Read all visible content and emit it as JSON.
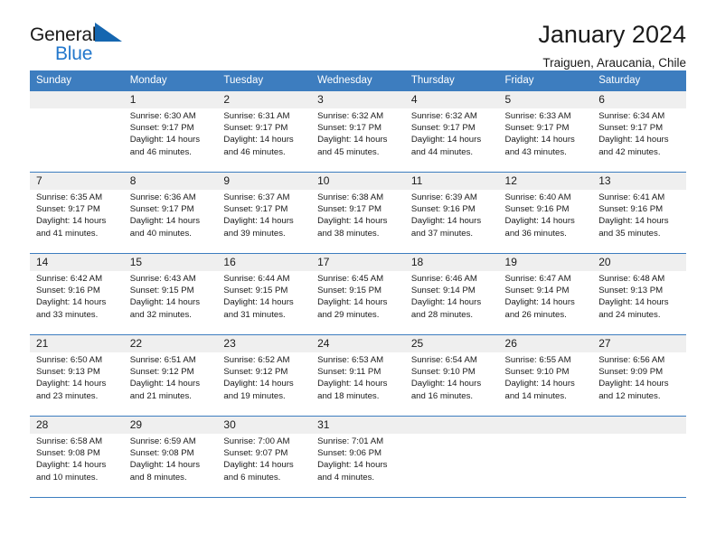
{
  "brand": {
    "name_top": "General",
    "name_bottom": "Blue",
    "mark": "triangle-flag-icon",
    "accent_color": "#2277cc"
  },
  "header": {
    "title": "January 2024",
    "subtitle": "Traiguen, Araucania, Chile"
  },
  "calendar": {
    "header_bg": "#3d7dbf",
    "daynum_bg": "#efefef",
    "weekdays": [
      "Sunday",
      "Monday",
      "Tuesday",
      "Wednesday",
      "Thursday",
      "Friday",
      "Saturday"
    ],
    "weeks": [
      [
        {
          "day": ""
        },
        {
          "day": "1",
          "sunrise": "Sunrise: 6:30 AM",
          "sunset": "Sunset: 9:17 PM",
          "daylight_1": "Daylight: 14 hours",
          "daylight_2": "and 46 minutes."
        },
        {
          "day": "2",
          "sunrise": "Sunrise: 6:31 AM",
          "sunset": "Sunset: 9:17 PM",
          "daylight_1": "Daylight: 14 hours",
          "daylight_2": "and 46 minutes."
        },
        {
          "day": "3",
          "sunrise": "Sunrise: 6:32 AM",
          "sunset": "Sunset: 9:17 PM",
          "daylight_1": "Daylight: 14 hours",
          "daylight_2": "and 45 minutes."
        },
        {
          "day": "4",
          "sunrise": "Sunrise: 6:32 AM",
          "sunset": "Sunset: 9:17 PM",
          "daylight_1": "Daylight: 14 hours",
          "daylight_2": "and 44 minutes."
        },
        {
          "day": "5",
          "sunrise": "Sunrise: 6:33 AM",
          "sunset": "Sunset: 9:17 PM",
          "daylight_1": "Daylight: 14 hours",
          "daylight_2": "and 43 minutes."
        },
        {
          "day": "6",
          "sunrise": "Sunrise: 6:34 AM",
          "sunset": "Sunset: 9:17 PM",
          "daylight_1": "Daylight: 14 hours",
          "daylight_2": "and 42 minutes."
        }
      ],
      [
        {
          "day": "7",
          "sunrise": "Sunrise: 6:35 AM",
          "sunset": "Sunset: 9:17 PM",
          "daylight_1": "Daylight: 14 hours",
          "daylight_2": "and 41 minutes."
        },
        {
          "day": "8",
          "sunrise": "Sunrise: 6:36 AM",
          "sunset": "Sunset: 9:17 PM",
          "daylight_1": "Daylight: 14 hours",
          "daylight_2": "and 40 minutes."
        },
        {
          "day": "9",
          "sunrise": "Sunrise: 6:37 AM",
          "sunset": "Sunset: 9:17 PM",
          "daylight_1": "Daylight: 14 hours",
          "daylight_2": "and 39 minutes."
        },
        {
          "day": "10",
          "sunrise": "Sunrise: 6:38 AM",
          "sunset": "Sunset: 9:17 PM",
          "daylight_1": "Daylight: 14 hours",
          "daylight_2": "and 38 minutes."
        },
        {
          "day": "11",
          "sunrise": "Sunrise: 6:39 AM",
          "sunset": "Sunset: 9:16 PM",
          "daylight_1": "Daylight: 14 hours",
          "daylight_2": "and 37 minutes."
        },
        {
          "day": "12",
          "sunrise": "Sunrise: 6:40 AM",
          "sunset": "Sunset: 9:16 PM",
          "daylight_1": "Daylight: 14 hours",
          "daylight_2": "and 36 minutes."
        },
        {
          "day": "13",
          "sunrise": "Sunrise: 6:41 AM",
          "sunset": "Sunset: 9:16 PM",
          "daylight_1": "Daylight: 14 hours",
          "daylight_2": "and 35 minutes."
        }
      ],
      [
        {
          "day": "14",
          "sunrise": "Sunrise: 6:42 AM",
          "sunset": "Sunset: 9:16 PM",
          "daylight_1": "Daylight: 14 hours",
          "daylight_2": "and 33 minutes."
        },
        {
          "day": "15",
          "sunrise": "Sunrise: 6:43 AM",
          "sunset": "Sunset: 9:15 PM",
          "daylight_1": "Daylight: 14 hours",
          "daylight_2": "and 32 minutes."
        },
        {
          "day": "16",
          "sunrise": "Sunrise: 6:44 AM",
          "sunset": "Sunset: 9:15 PM",
          "daylight_1": "Daylight: 14 hours",
          "daylight_2": "and 31 minutes."
        },
        {
          "day": "17",
          "sunrise": "Sunrise: 6:45 AM",
          "sunset": "Sunset: 9:15 PM",
          "daylight_1": "Daylight: 14 hours",
          "daylight_2": "and 29 minutes."
        },
        {
          "day": "18",
          "sunrise": "Sunrise: 6:46 AM",
          "sunset": "Sunset: 9:14 PM",
          "daylight_1": "Daylight: 14 hours",
          "daylight_2": "and 28 minutes."
        },
        {
          "day": "19",
          "sunrise": "Sunrise: 6:47 AM",
          "sunset": "Sunset: 9:14 PM",
          "daylight_1": "Daylight: 14 hours",
          "daylight_2": "and 26 minutes."
        },
        {
          "day": "20",
          "sunrise": "Sunrise: 6:48 AM",
          "sunset": "Sunset: 9:13 PM",
          "daylight_1": "Daylight: 14 hours",
          "daylight_2": "and 24 minutes."
        }
      ],
      [
        {
          "day": "21",
          "sunrise": "Sunrise: 6:50 AM",
          "sunset": "Sunset: 9:13 PM",
          "daylight_1": "Daylight: 14 hours",
          "daylight_2": "and 23 minutes."
        },
        {
          "day": "22",
          "sunrise": "Sunrise: 6:51 AM",
          "sunset": "Sunset: 9:12 PM",
          "daylight_1": "Daylight: 14 hours",
          "daylight_2": "and 21 minutes."
        },
        {
          "day": "23",
          "sunrise": "Sunrise: 6:52 AM",
          "sunset": "Sunset: 9:12 PM",
          "daylight_1": "Daylight: 14 hours",
          "daylight_2": "and 19 minutes."
        },
        {
          "day": "24",
          "sunrise": "Sunrise: 6:53 AM",
          "sunset": "Sunset: 9:11 PM",
          "daylight_1": "Daylight: 14 hours",
          "daylight_2": "and 18 minutes."
        },
        {
          "day": "25",
          "sunrise": "Sunrise: 6:54 AM",
          "sunset": "Sunset: 9:10 PM",
          "daylight_1": "Daylight: 14 hours",
          "daylight_2": "and 16 minutes."
        },
        {
          "day": "26",
          "sunrise": "Sunrise: 6:55 AM",
          "sunset": "Sunset: 9:10 PM",
          "daylight_1": "Daylight: 14 hours",
          "daylight_2": "and 14 minutes."
        },
        {
          "day": "27",
          "sunrise": "Sunrise: 6:56 AM",
          "sunset": "Sunset: 9:09 PM",
          "daylight_1": "Daylight: 14 hours",
          "daylight_2": "and 12 minutes."
        }
      ],
      [
        {
          "day": "28",
          "sunrise": "Sunrise: 6:58 AM",
          "sunset": "Sunset: 9:08 PM",
          "daylight_1": "Daylight: 14 hours",
          "daylight_2": "and 10 minutes."
        },
        {
          "day": "29",
          "sunrise": "Sunrise: 6:59 AM",
          "sunset": "Sunset: 9:08 PM",
          "daylight_1": "Daylight: 14 hours",
          "daylight_2": "and 8 minutes."
        },
        {
          "day": "30",
          "sunrise": "Sunrise: 7:00 AM",
          "sunset": "Sunset: 9:07 PM",
          "daylight_1": "Daylight: 14 hours",
          "daylight_2": "and 6 minutes."
        },
        {
          "day": "31",
          "sunrise": "Sunrise: 7:01 AM",
          "sunset": "Sunset: 9:06 PM",
          "daylight_1": "Daylight: 14 hours",
          "daylight_2": "and 4 minutes."
        },
        {
          "day": ""
        },
        {
          "day": ""
        },
        {
          "day": ""
        }
      ]
    ]
  }
}
